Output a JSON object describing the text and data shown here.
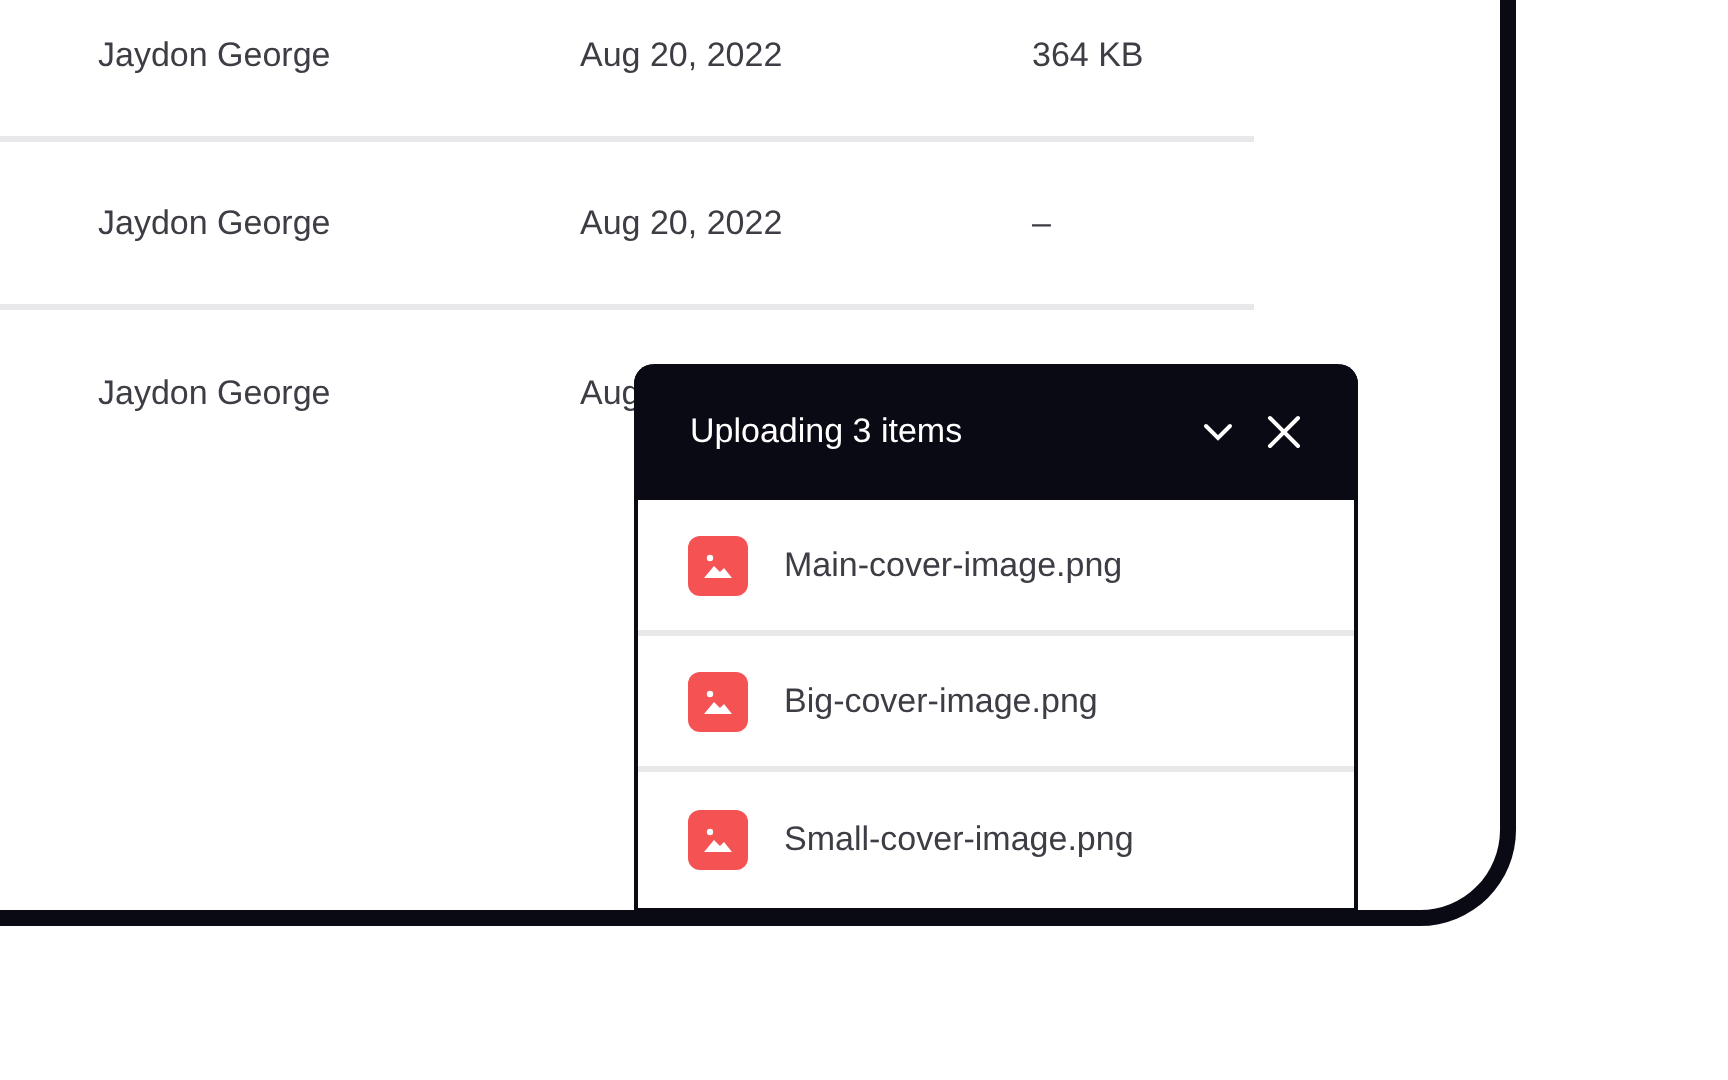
{
  "table": {
    "rows": [
      {
        "owner": "Jaydon George",
        "date": "Aug 20, 2022",
        "size": "364 KB"
      },
      {
        "owner": "Jaydon George",
        "date": "Aug 20, 2022",
        "size": "–"
      },
      {
        "owner": "Jaydon George",
        "date": "Aug"
      }
    ]
  },
  "upload_panel": {
    "title": "Uploading 3 items",
    "files": [
      {
        "name": "Main-cover-image.png"
      },
      {
        "name": "Big-cover-image.png"
      },
      {
        "name": "Small-cover-image.png"
      }
    ]
  }
}
